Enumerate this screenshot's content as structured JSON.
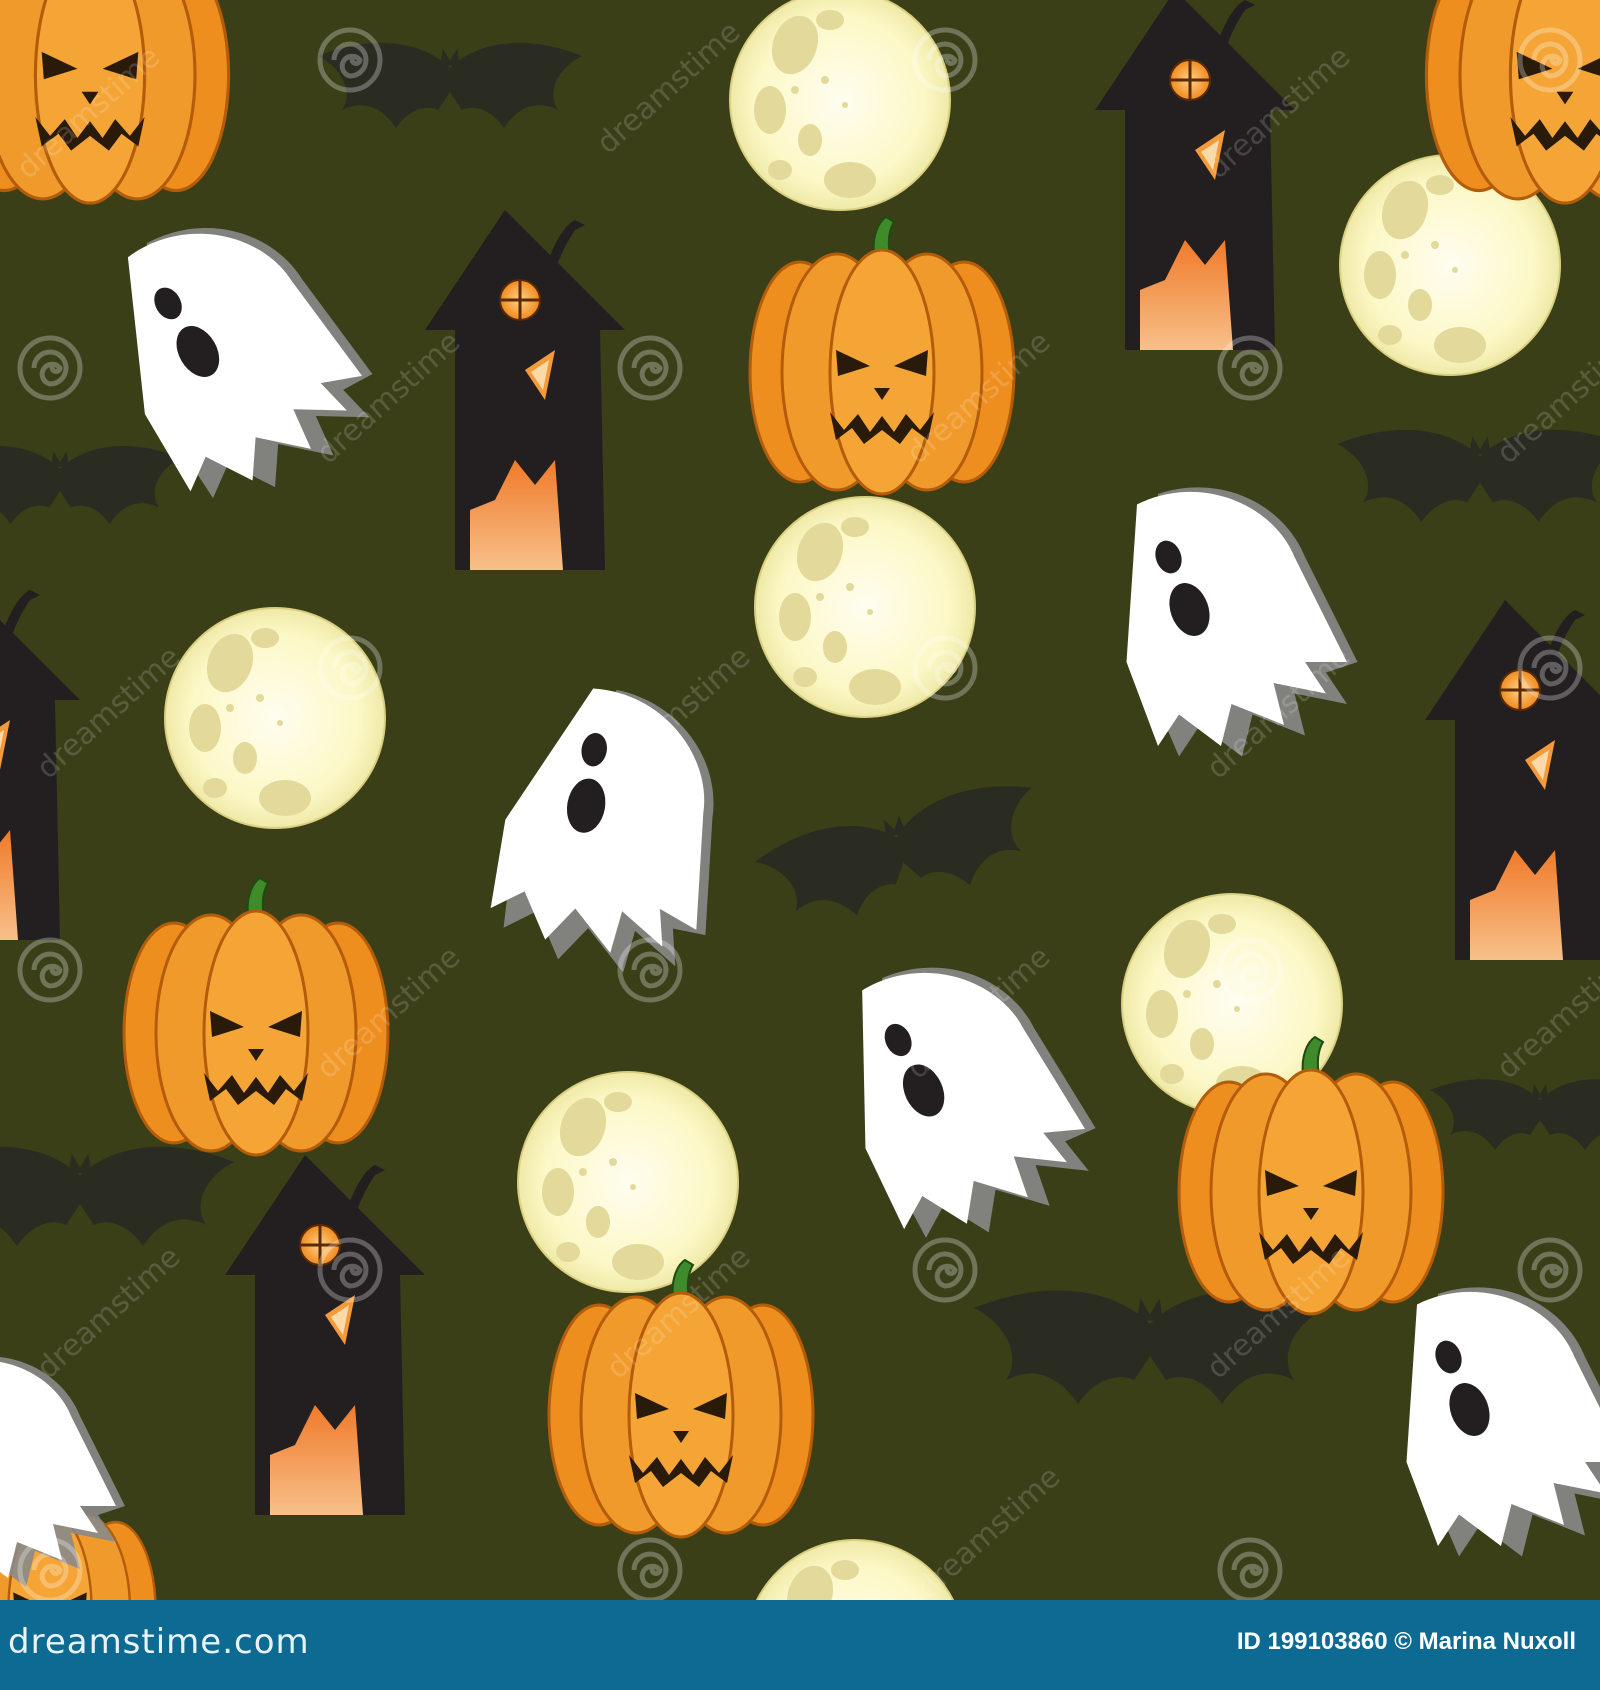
{
  "scene": {
    "background_color": "#3a3f18",
    "elements": [
      "pumpkin",
      "ghost",
      "bat",
      "full-moon",
      "haunted-house",
      "watermark-swirl"
    ],
    "colors": {
      "pumpkin": "#ee8e1e",
      "pumpkin_stem": "#3f8a2a",
      "ghost": "#ffffff",
      "moon": "#fcf8c6",
      "house": "#231f20",
      "window": "#f9a73c",
      "bat": "#2a2c22"
    }
  },
  "watermark": {
    "text": "dreamstime",
    "color": "rgba(255,255,255,0.16)"
  },
  "footer": {
    "brand": "dreamstime.com",
    "credit": "ID 199103860 © Marina Nuxoll",
    "background_color": "#0d6a93"
  }
}
